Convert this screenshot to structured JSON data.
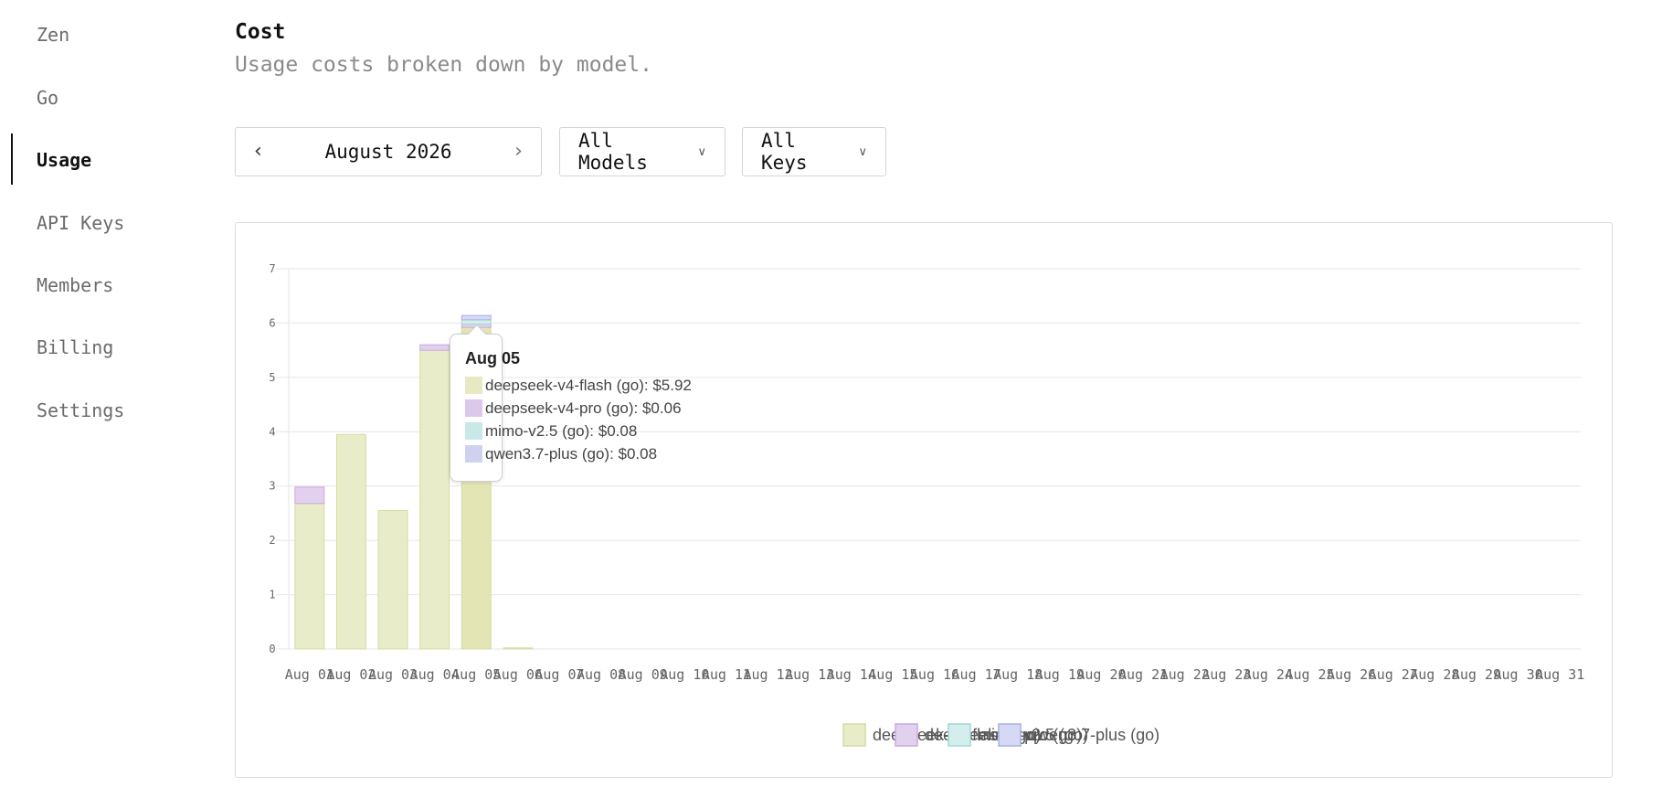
{
  "sidebar": {
    "items": [
      {
        "label": "Zen",
        "active": false
      },
      {
        "label": "Go",
        "active": false
      },
      {
        "label": "Usage",
        "active": true
      },
      {
        "label": "API Keys",
        "active": false
      },
      {
        "label": "Members",
        "active": false
      },
      {
        "label": "Billing",
        "active": false
      },
      {
        "label": "Settings",
        "active": false
      }
    ]
  },
  "header": {
    "title": "Cost",
    "subtitle": "Usage costs broken down by model."
  },
  "filters": {
    "month": "August 2026",
    "model": "All Models",
    "key": "All Keys"
  },
  "tooltip": {
    "title": "Aug 05",
    "rows": [
      {
        "text": "deepseek-v4-flash (go): $5.92",
        "color": "#e2e6b8"
      },
      {
        "text": "deepseek-v4-pro (go): $0.06",
        "color": "#d7bfe6"
      },
      {
        "text": "mimo-v2.5 (go): $0.08",
        "color": "#bfe6e3"
      },
      {
        "text": "qwen3.7-plus (go): $0.08",
        "color": "#c6cbee"
      }
    ]
  },
  "chart_data": {
    "type": "bar",
    "stacked": true,
    "categories": [
      "Aug 01",
      "Aug 02",
      "Aug 03",
      "Aug 04",
      "Aug 05",
      "Aug 06",
      "Aug 07",
      "Aug 08",
      "Aug 09",
      "Aug 10",
      "Aug 11",
      "Aug 12",
      "Aug 13",
      "Aug 14",
      "Aug 15",
      "Aug 16",
      "Aug 17",
      "Aug 18",
      "Aug 19",
      "Aug 20",
      "Aug 21",
      "Aug 22",
      "Aug 23",
      "Aug 24",
      "Aug 25",
      "Aug 26",
      "Aug 27",
      "Aug 28",
      "Aug 29",
      "Aug 30",
      "Aug 31"
    ],
    "yticks": [
      "0",
      "1",
      "2",
      "3",
      "4",
      "5",
      "6",
      "7"
    ],
    "ylim": [
      0,
      7
    ],
    "grid": true,
    "legend_position": "bottom",
    "series": [
      {
        "name": "deepseek-v4-flash (go)",
        "fill": "#e9ecc9",
        "stroke": "#d6dca0",
        "values": [
          2.68,
          3.95,
          2.55,
          5.5,
          5.92,
          0.02,
          0,
          0,
          0,
          0,
          0,
          0,
          0,
          0,
          0,
          0,
          0,
          0,
          0,
          0,
          0,
          0,
          0,
          0,
          0,
          0,
          0,
          0,
          0,
          0,
          0
        ]
      },
      {
        "name": "deepseek-v4-pro (go)",
        "fill": "#e2d1ee",
        "stroke": "#c9a8e0",
        "values": [
          0.3,
          0,
          0,
          0.1,
          0.06,
          0,
          0,
          0,
          0,
          0,
          0,
          0,
          0,
          0,
          0,
          0,
          0,
          0,
          0,
          0,
          0,
          0,
          0,
          0,
          0,
          0,
          0,
          0,
          0,
          0,
          0
        ]
      },
      {
        "name": "mimo-v2.5 (go)",
        "fill": "#d3eeec",
        "stroke": "#9fd9d4",
        "values": [
          0,
          0,
          0,
          0,
          0.08,
          0,
          0,
          0,
          0,
          0,
          0,
          0,
          0,
          0,
          0,
          0,
          0,
          0,
          0,
          0,
          0,
          0,
          0,
          0,
          0,
          0,
          0,
          0,
          0,
          0,
          0
        ]
      },
      {
        "name": "qwen3.7-plus (go)",
        "fill": "#d5d9f3",
        "stroke": "#a8b0e6",
        "values": [
          0,
          0,
          0,
          0,
          0.08,
          0,
          0,
          0,
          0,
          0,
          0,
          0,
          0,
          0,
          0,
          0,
          0,
          0,
          0,
          0,
          0,
          0,
          0,
          0,
          0,
          0,
          0,
          0,
          0,
          0,
          0
        ]
      }
    ],
    "highlight_index": 4
  }
}
